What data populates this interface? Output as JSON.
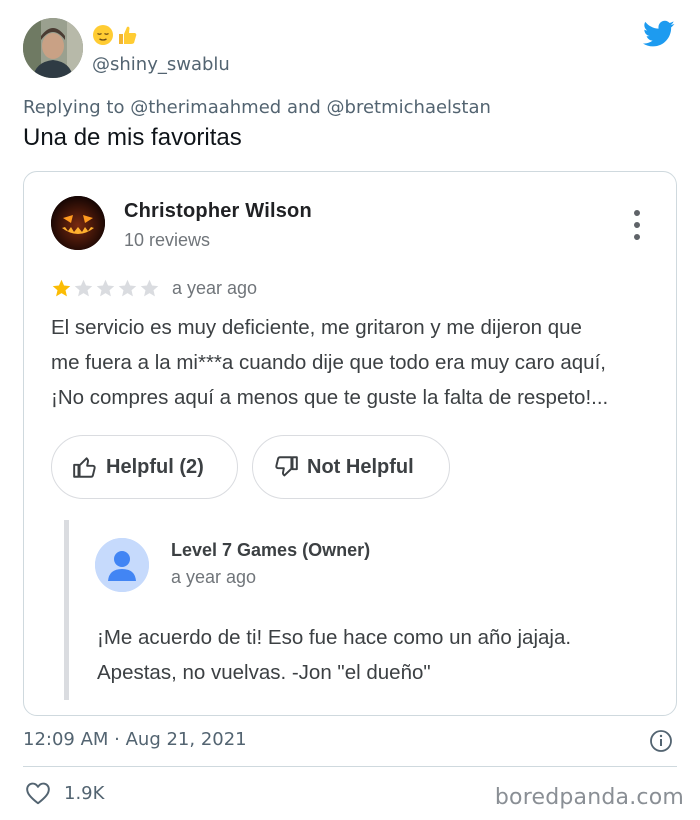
{
  "tweet": {
    "handle": "@shiny_swablu",
    "name_emojis": [
      "relieved-face-emoji",
      "thumbs-up-emoji"
    ],
    "reply_prefix": "Replying to",
    "reply_mention_1": "@therimaahmed",
    "reply_and": "and",
    "reply_mention_2": "@bretmichaelstan",
    "text": "Una de mis favoritas",
    "timestamp": "12:09 AM · Aug 21, 2021",
    "likes": "1.9K",
    "brand_color": "#1d9bf0"
  },
  "review": {
    "reviewer_name": "Christopher Wilson",
    "reviewer_reviews": "10 reviews",
    "rating": 1,
    "rating_max": 5,
    "time": "a year ago",
    "body_lines": [
      "El servicio es muy deficiente, me gritaron y me dijeron que",
      "me fuera a la mi***a cuando dije que todo era muy caro aquí,",
      "¡No compres aquí a menos que te guste la falta de respeto!..."
    ],
    "helpful_label": "Helpful (2)",
    "not_helpful_label": "Not Helpful",
    "star_color": "#fbbc04",
    "star_empty_color": "#dadce0"
  },
  "owner_reply": {
    "name": "Level 7 Games (Owner)",
    "time": "a year ago",
    "lines": [
      "¡Me acuerdo de ti! Eso fue hace como un año jajaja.",
      "Apestas, no vuelvas. -Jon \"el dueño\""
    ]
  },
  "watermark": "boredpanda.com"
}
